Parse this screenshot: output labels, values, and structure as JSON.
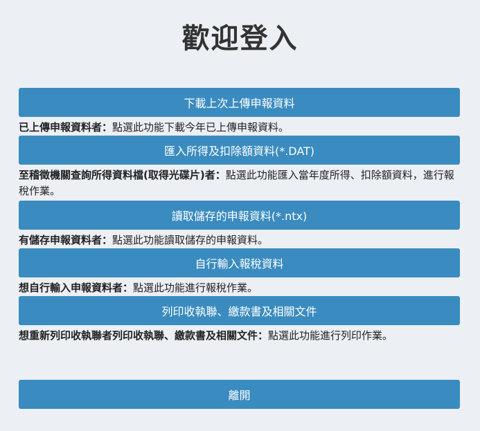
{
  "page": {
    "title": "歡迎登入"
  },
  "options": [
    {
      "button": "下載上次上傳申報資料",
      "label": "已上傳申報資料者：",
      "text": "點選此功能下載今年已上傳申報資料。"
    },
    {
      "button": "匯入所得及扣除額資料(*.DAT)",
      "label": "至稽徵機關查詢所得資料檔(取得光碟片)者：",
      "text": "點選此功能匯入當年度所得、扣除額資料，進行報稅作業。"
    },
    {
      "button": "讀取儲存的申報資料(*.ntx)",
      "label": "有儲存申報資料者：",
      "text": "點選此功能讀取儲存的申報資料。"
    },
    {
      "button": "自行輸入報稅資料",
      "label": "想自行輸入申報資料者：",
      "text": "點選此功能進行報稅作業。"
    },
    {
      "button": "列印收執聯、繳款書及相關文件",
      "label": "想重新列印收執聯者列印收執聯、繳款書及相關文件：",
      "text": "點選此功能進行列印作業。"
    }
  ],
  "exit": {
    "button": "離開"
  }
}
